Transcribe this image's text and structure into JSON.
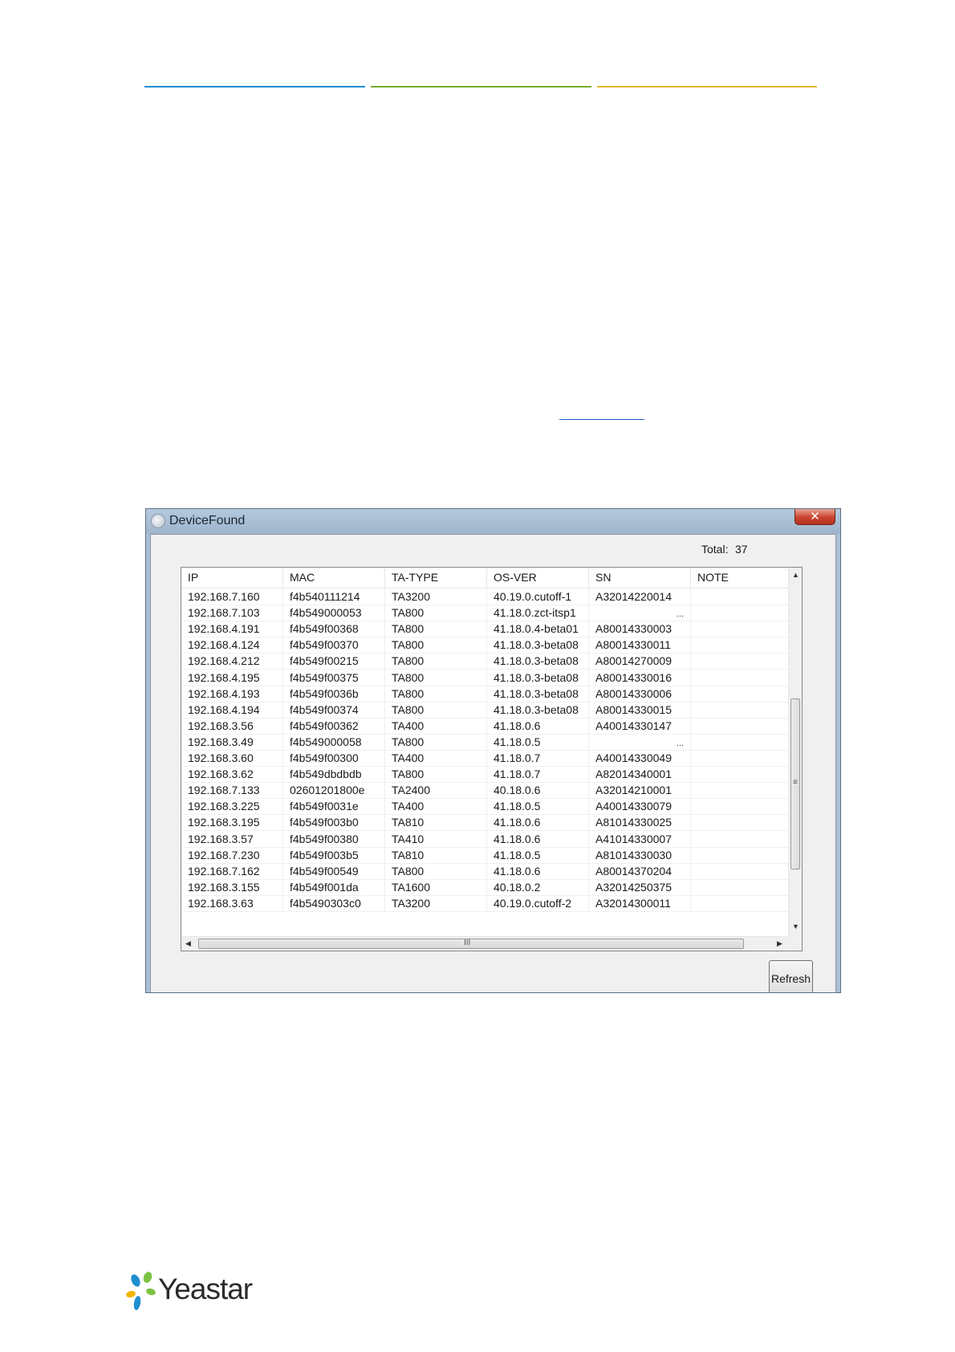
{
  "colors": {
    "rule_blue": "#1e8fd0",
    "rule_green": "#7aab2b",
    "rule_yellow": "#e4b82a",
    "link": "#1a5fc8",
    "logo_blue": "#1e8fd0",
    "logo_green": "#7cc242",
    "logo_yellow": "#f4b400"
  },
  "window": {
    "title": "DeviceFound",
    "close_glyph": "✕",
    "total_label": "Total:",
    "total_value": "37",
    "columns": [
      "IP",
      "MAC",
      "TA-TYPE",
      "OS-VER",
      "SN",
      "NOTE"
    ],
    "rows": [
      [
        "192.168.7.160",
        "f4b540111214",
        "TA3200",
        "40.19.0.cutoff-1",
        "A32014220014",
        ""
      ],
      [
        "192.168.7.103",
        "f4b549000053",
        "TA800",
        "41.18.0.zct-itsp1",
        "",
        ""
      ],
      [
        "192.168.4.191",
        "f4b549f00368",
        "TA800",
        "41.18.0.4-beta01",
        "A80014330003",
        ""
      ],
      [
        "192.168.4.124",
        "f4b549f00370",
        "TA800",
        "41.18.0.3-beta08",
        "A80014330011",
        ""
      ],
      [
        "192.168.4.212",
        "f4b549f00215",
        "TA800",
        "41.18.0.3-beta08",
        "A80014270009",
        ""
      ],
      [
        "192.168.4.195",
        "f4b549f00375",
        "TA800",
        "41.18.0.3-beta08",
        "A80014330016",
        ""
      ],
      [
        "192.168.4.193",
        "f4b549f0036b",
        "TA800",
        "41.18.0.3-beta08",
        "A80014330006",
        ""
      ],
      [
        "192.168.4.194",
        "f4b549f00374",
        "TA800",
        "41.18.0.3-beta08",
        "A80014330015",
        ""
      ],
      [
        "192.168.3.56",
        "f4b549f00362",
        "TA400",
        "41.18.0.6",
        "A40014330147",
        ""
      ],
      [
        "192.168.3.49",
        "f4b549000058",
        "TA800",
        "41.18.0.5",
        "",
        ""
      ],
      [
        "192.168.3.60",
        "f4b549f00300",
        "TA400",
        "41.18.0.7",
        "A40014330049",
        ""
      ],
      [
        "192.168.3.62",
        "f4b549dbdbdb",
        "TA800",
        "41.18.0.7",
        "A82014340001",
        ""
      ],
      [
        "192.168.7.133",
        "02601201800e",
        "TA2400",
        "40.18.0.6",
        "A32014210001",
        ""
      ],
      [
        "192.168.3.225",
        "f4b549f0031e",
        "TA400",
        "41.18.0.5",
        "A40014330079",
        ""
      ],
      [
        "192.168.3.195",
        "f4b549f003b0",
        "TA810",
        "41.18.0.6",
        "A81014330025",
        ""
      ],
      [
        "192.168.3.57",
        "f4b549f00380",
        "TA410",
        "41.18.0.6",
        "A41014330007",
        ""
      ],
      [
        "192.168.7.230",
        "f4b549f003b5",
        "TA810",
        "41.18.0.5",
        "A81014330030",
        ""
      ],
      [
        "192.168.7.162",
        "f4b549f00549",
        "TA800",
        "41.18.0.6",
        "A80014370204",
        ""
      ],
      [
        "192.168.3.155",
        "f4b549f001da",
        "TA1600",
        "40.18.0.2",
        "A32014250375",
        ""
      ],
      [
        "192.168.3.63",
        "f4b5490303c0",
        "TA3200",
        "40.19.0.cutoff-2",
        "A32014300011",
        ""
      ]
    ],
    "ellipsis_rows": [
      1,
      9
    ],
    "ellipsis_text": "...",
    "scroll_up": "▲",
    "scroll_down": "▼",
    "scroll_left": "◀",
    "scroll_right": "▶",
    "vgrip": "≡",
    "hgrip": "III",
    "refresh_label": "Refresh"
  },
  "logo": {
    "text": "Yeastar",
    "icon": "yeastar-star-logo"
  }
}
